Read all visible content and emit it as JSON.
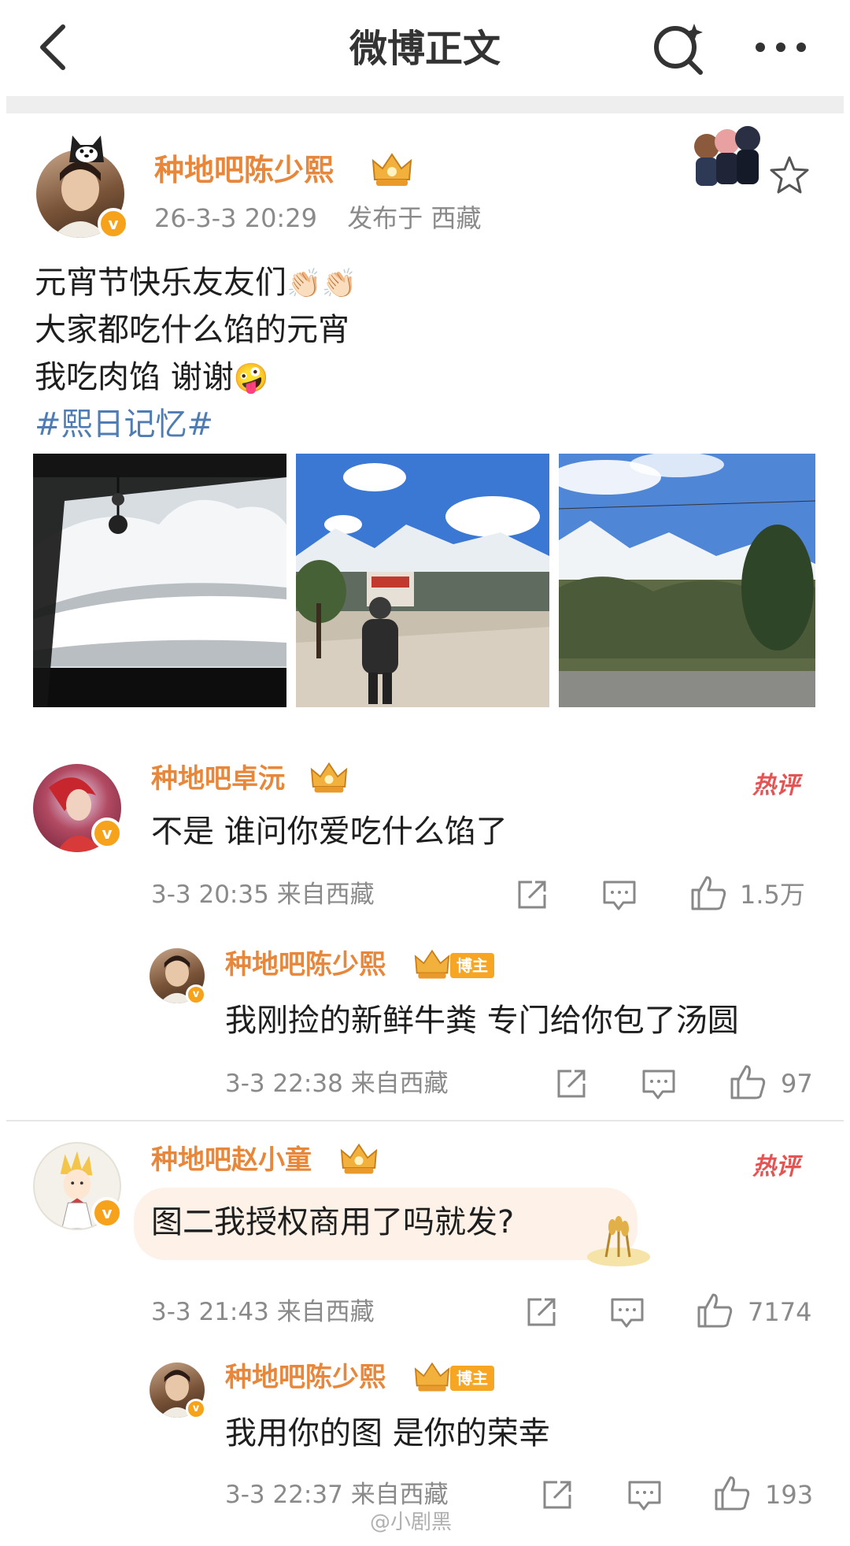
{
  "header": {
    "title": "微博正文",
    "back_icon": "chevron-left-icon",
    "search_icon": "search-icon",
    "more_icon": "more-icon"
  },
  "post": {
    "author": "种地吧陈少熙",
    "timestamp": "26-3-3 20:29",
    "location": "发布于 西藏",
    "lines": [
      "元宵节快乐友友们",
      "大家都吃什么馅的元宵",
      "我吃肉馅 谢谢"
    ],
    "hashtag": "#熙日记忆#",
    "images": [
      {
        "name": "snow-mountain-car-window-photo"
      },
      {
        "name": "person-walking-mountain-road-photo"
      },
      {
        "name": "snow-mountain-forest-photo"
      }
    ]
  },
  "comments": [
    {
      "author": "种地吧卓沅",
      "hot_label": "热评",
      "text": "不是 谁问你爱吃什么馅了",
      "time": "3-3 20:35",
      "location": "来自西藏",
      "likes": "1.5万",
      "reply": {
        "author": "种地吧陈少熙",
        "author_tag": "博主",
        "text": "我刚捡的新鲜牛粪 专门给你包了汤圆",
        "time": "3-3 22:38",
        "location": "来自西藏",
        "likes": "97"
      }
    },
    {
      "author": "种地吧赵小童",
      "hot_label": "热评",
      "text": "图二我授权商用了吗就发?",
      "time": "3-3 21:43",
      "location": "来自西藏",
      "likes": "7174",
      "reply": {
        "author": "种地吧陈少熙",
        "author_tag": "博主",
        "text": "我用你的图 是你的荣幸",
        "time": "3-3 22:37",
        "location": "来自西藏",
        "likes": "193"
      }
    }
  ],
  "watermark": "@小剧黑",
  "colors": {
    "username": "#e8873a",
    "hashtag": "#4f7db3",
    "meta": "#8a8a8a",
    "hot": "#e65353",
    "author_tag": "#f6a623"
  }
}
